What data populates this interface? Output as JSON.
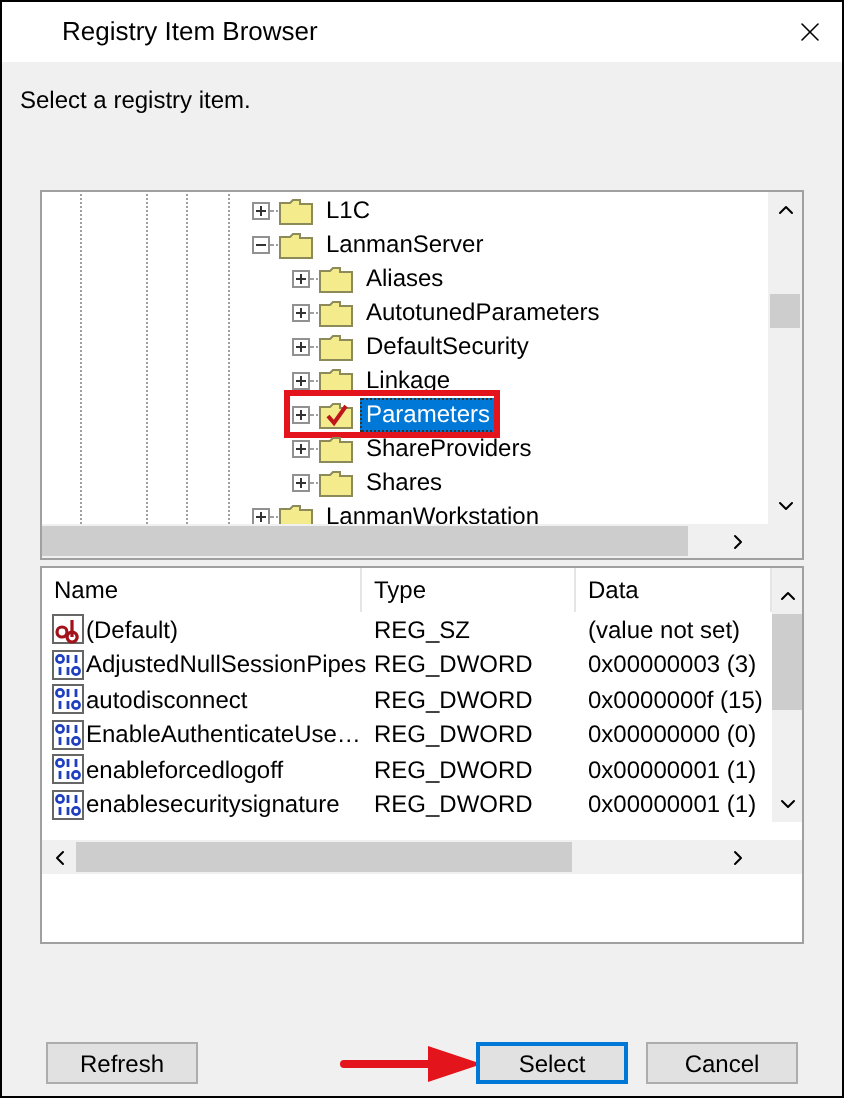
{
  "window": {
    "title": "Registry Item Browser"
  },
  "prompt": "Select a registry item.",
  "tree": [
    {
      "label": "L1C",
      "expanded": false,
      "selected": false,
      "highlighted": false
    },
    {
      "label": "LanmanServer",
      "expanded": true,
      "selected": false,
      "highlighted": false,
      "children": [
        {
          "label": "Aliases",
          "expanded": false,
          "selected": false,
          "highlighted": false
        },
        {
          "label": "AutotunedParameters",
          "expanded": false,
          "selected": false,
          "highlighted": false
        },
        {
          "label": "DefaultSecurity",
          "expanded": false,
          "selected": false,
          "highlighted": false
        },
        {
          "label": "Linkage",
          "expanded": false,
          "selected": false,
          "highlighted": false
        },
        {
          "label": "Parameters",
          "expanded": false,
          "selected": true,
          "highlighted": true
        },
        {
          "label": "ShareProviders",
          "expanded": false,
          "selected": false,
          "highlighted": false
        },
        {
          "label": "Shares",
          "expanded": false,
          "selected": false,
          "highlighted": false
        }
      ]
    },
    {
      "label": "LanmanWorkstation",
      "expanded": false,
      "selected": false,
      "highlighted": false
    }
  ],
  "values": {
    "columns": [
      "Name",
      "Type",
      "Data"
    ],
    "rows": [
      {
        "kind": "string",
        "name": "(Default)",
        "type": "REG_SZ",
        "data": "(value not set)"
      },
      {
        "kind": "dword",
        "name": "AdjustedNullSessionPipes",
        "type": "REG_DWORD",
        "data": "0x00000003 (3)"
      },
      {
        "kind": "dword",
        "name": "autodisconnect",
        "type": "REG_DWORD",
        "data": "0x0000000f (15)"
      },
      {
        "kind": "dword",
        "name": "EnableAuthenticateUse…",
        "type": "REG_DWORD",
        "data": "0x00000000 (0)"
      },
      {
        "kind": "dword",
        "name": "enableforcedlogoff",
        "type": "REG_DWORD",
        "data": "0x00000001 (1)"
      },
      {
        "kind": "dword",
        "name": "enablesecuritysignature",
        "type": "REG_DWORD",
        "data": "0x00000001 (1)"
      }
    ]
  },
  "buttons": [
    {
      "label": "Refresh",
      "default": false,
      "highlighted": false
    },
    {
      "label": "Select",
      "default": true,
      "highlighted": true
    },
    {
      "label": "Cancel",
      "default": false,
      "highlighted": false
    }
  ]
}
